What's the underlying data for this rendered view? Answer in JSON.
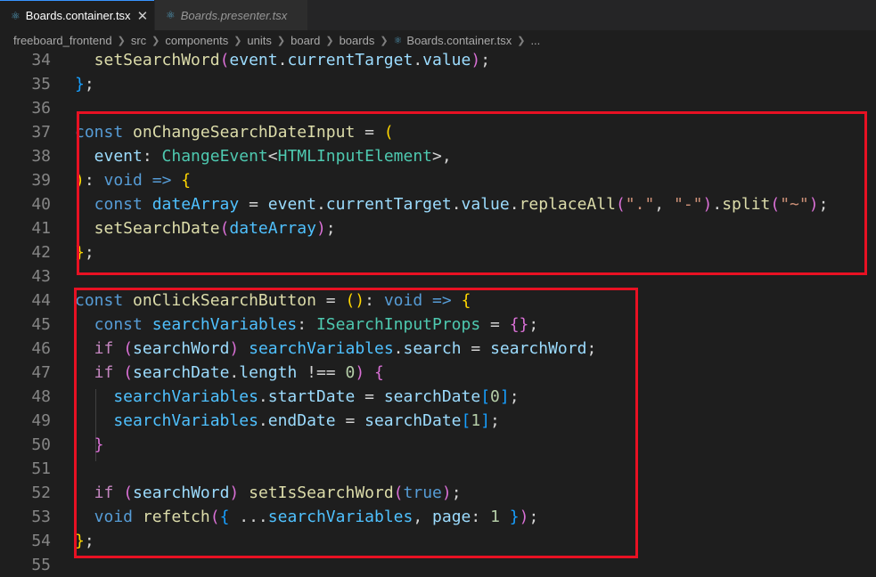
{
  "tabs": [
    {
      "label": "Boards.container.tsx",
      "icon": "react-icon",
      "active": true
    },
    {
      "label": "Boards.presenter.tsx",
      "icon": "react-icon",
      "active": false
    }
  ],
  "breadcrumb": [
    "freeboard_frontend",
    "src",
    "components",
    "units",
    "board",
    "boards",
    "Boards.container.tsx",
    "..."
  ],
  "highlight_color": "#e81123",
  "editor": {
    "lines": [
      {
        "n": "34",
        "tokens": [
          [
            "  setSearchWord",
            "fn"
          ],
          [
            "(",
            "b2"
          ],
          [
            "event",
            "vr"
          ],
          [
            ".",
            "pu"
          ],
          [
            "currentTarget",
            "vr"
          ],
          [
            ".",
            "pu"
          ],
          [
            "value",
            "vr"
          ],
          [
            ")",
            "b2"
          ],
          [
            ";",
            "pu"
          ]
        ]
      },
      {
        "n": "35",
        "tokens": [
          [
            "}",
            "b3"
          ],
          [
            ";",
            "pu"
          ]
        ]
      },
      {
        "n": "36",
        "tokens": []
      },
      {
        "n": "37",
        "tokens": [
          [
            "const",
            "kw"
          ],
          [
            " ",
            "pu"
          ],
          [
            "onChangeSearchDateInput",
            "fn"
          ],
          [
            " = ",
            "pu"
          ],
          [
            "(",
            "b1"
          ]
        ]
      },
      {
        "n": "38",
        "tokens": [
          [
            "  event",
            "vr"
          ],
          [
            ": ",
            "pu"
          ],
          [
            "ChangeEvent",
            "ty"
          ],
          [
            "<",
            "pu"
          ],
          [
            "HTMLInputElement",
            "ty"
          ],
          [
            ">",
            "pu"
          ],
          [
            ",",
            "pu"
          ]
        ]
      },
      {
        "n": "39",
        "tokens": [
          [
            ")",
            "b1"
          ],
          [
            ": ",
            "pu"
          ],
          [
            "void",
            "kw"
          ],
          [
            " ",
            "pu"
          ],
          [
            "=>",
            "kw"
          ],
          [
            " ",
            "pu"
          ],
          [
            "{",
            "b1"
          ]
        ]
      },
      {
        "n": "40",
        "tokens": [
          [
            "  const",
            "kw"
          ],
          [
            " ",
            "pu"
          ],
          [
            "dateArray",
            "cn"
          ],
          [
            " = ",
            "pu"
          ],
          [
            "event",
            "vr"
          ],
          [
            ".",
            "pu"
          ],
          [
            "currentTarget",
            "vr"
          ],
          [
            ".",
            "pu"
          ],
          [
            "value",
            "vr"
          ],
          [
            ".",
            "pu"
          ],
          [
            "replaceAll",
            "fn"
          ],
          [
            "(",
            "b2"
          ],
          [
            "\".\"",
            "st"
          ],
          [
            ", ",
            "pu"
          ],
          [
            "\"-\"",
            "st"
          ],
          [
            ")",
            "b2"
          ],
          [
            ".",
            "pu"
          ],
          [
            "split",
            "fn"
          ],
          [
            "(",
            "b2"
          ],
          [
            "\"~\"",
            "st"
          ],
          [
            ")",
            "b2"
          ],
          [
            ";",
            "pu"
          ]
        ]
      },
      {
        "n": "41",
        "tokens": [
          [
            "  setSearchDate",
            "fn"
          ],
          [
            "(",
            "b2"
          ],
          [
            "dateArray",
            "cn"
          ],
          [
            ")",
            "b2"
          ],
          [
            ";",
            "pu"
          ]
        ]
      },
      {
        "n": "42",
        "tokens": [
          [
            "}",
            "b1"
          ],
          [
            ";",
            "pu"
          ]
        ]
      },
      {
        "n": "43",
        "tokens": []
      },
      {
        "n": "44",
        "tokens": [
          [
            "const",
            "kw"
          ],
          [
            " ",
            "pu"
          ],
          [
            "onClickSearchButton",
            "fn"
          ],
          [
            " = ",
            "pu"
          ],
          [
            "()",
            "b1"
          ],
          [
            ": ",
            "pu"
          ],
          [
            "void",
            "kw"
          ],
          [
            " ",
            "pu"
          ],
          [
            "=>",
            "kw"
          ],
          [
            " ",
            "pu"
          ],
          [
            "{",
            "b1"
          ]
        ]
      },
      {
        "n": "45",
        "tokens": [
          [
            "  const",
            "kw"
          ],
          [
            " ",
            "pu"
          ],
          [
            "searchVariables",
            "cn"
          ],
          [
            ": ",
            "pu"
          ],
          [
            "ISearchInputProps",
            "ty"
          ],
          [
            " = ",
            "pu"
          ],
          [
            "{}",
            "b2"
          ],
          [
            ";",
            "pu"
          ]
        ]
      },
      {
        "n": "46",
        "tokens": [
          [
            "  if",
            "ctl"
          ],
          [
            " ",
            "pu"
          ],
          [
            "(",
            "b2"
          ],
          [
            "searchWord",
            "vr"
          ],
          [
            ")",
            "b2"
          ],
          [
            " ",
            "pu"
          ],
          [
            "searchVariables",
            "cn"
          ],
          [
            ".",
            "pu"
          ],
          [
            "search",
            "vr"
          ],
          [
            " = ",
            "pu"
          ],
          [
            "searchWord",
            "vr"
          ],
          [
            ";",
            "pu"
          ]
        ]
      },
      {
        "n": "47",
        "tokens": [
          [
            "  if",
            "ctl"
          ],
          [
            " ",
            "pu"
          ],
          [
            "(",
            "b2"
          ],
          [
            "searchDate",
            "vr"
          ],
          [
            ".",
            "pu"
          ],
          [
            "length",
            "vr"
          ],
          [
            " !== ",
            "pu"
          ],
          [
            "0",
            "nu"
          ],
          [
            ")",
            "b2"
          ],
          [
            " ",
            "pu"
          ],
          [
            "{",
            "b2"
          ]
        ]
      },
      {
        "n": "48",
        "tokens": [
          [
            "    searchVariables",
            "cn"
          ],
          [
            ".",
            "pu"
          ],
          [
            "startDate",
            "vr"
          ],
          [
            " = ",
            "pu"
          ],
          [
            "searchDate",
            "vr"
          ],
          [
            "[",
            "b3"
          ],
          [
            "0",
            "nu"
          ],
          [
            "]",
            "b3"
          ],
          [
            ";",
            "pu"
          ]
        ]
      },
      {
        "n": "49",
        "tokens": [
          [
            "    searchVariables",
            "cn"
          ],
          [
            ".",
            "pu"
          ],
          [
            "endDate",
            "vr"
          ],
          [
            " = ",
            "pu"
          ],
          [
            "searchDate",
            "vr"
          ],
          [
            "[",
            "b3"
          ],
          [
            "1",
            "nu"
          ],
          [
            "]",
            "b3"
          ],
          [
            ";",
            "pu"
          ]
        ]
      },
      {
        "n": "50",
        "tokens": [
          [
            "  }",
            "b2"
          ]
        ]
      },
      {
        "n": "51",
        "tokens": []
      },
      {
        "n": "52",
        "tokens": [
          [
            "  if",
            "ctl"
          ],
          [
            " ",
            "pu"
          ],
          [
            "(",
            "b2"
          ],
          [
            "searchWord",
            "vr"
          ],
          [
            ")",
            "b2"
          ],
          [
            " ",
            "pu"
          ],
          [
            "setIsSearchWord",
            "fn"
          ],
          [
            "(",
            "b2"
          ],
          [
            "true",
            "kw"
          ],
          [
            ")",
            "b2"
          ],
          [
            ";",
            "pu"
          ]
        ]
      },
      {
        "n": "53",
        "tokens": [
          [
            "  void",
            "kw"
          ],
          [
            " ",
            "pu"
          ],
          [
            "refetch",
            "fn"
          ],
          [
            "(",
            "b2"
          ],
          [
            "{",
            "b3"
          ],
          [
            " ...",
            "pu"
          ],
          [
            "searchVariables",
            "cn"
          ],
          [
            ", ",
            "pu"
          ],
          [
            "page",
            "vr"
          ],
          [
            ": ",
            "pu"
          ],
          [
            "1",
            "nu"
          ],
          [
            " ",
            "pu"
          ],
          [
            "}",
            "b3"
          ],
          [
            ")",
            "b2"
          ],
          [
            ";",
            "pu"
          ]
        ]
      },
      {
        "n": "54",
        "tokens": [
          [
            "}",
            "b1"
          ],
          [
            ";",
            "pu"
          ]
        ]
      },
      {
        "n": "55",
        "tokens": []
      }
    ]
  }
}
